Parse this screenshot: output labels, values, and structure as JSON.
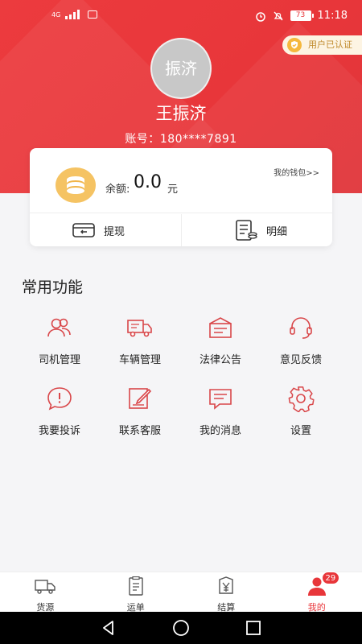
{
  "status_bar": {
    "network": "4G",
    "battery": "73",
    "time": "11:18"
  },
  "verified_badge": "用户已认证",
  "profile": {
    "avatar_text": "振济",
    "name": "王振济",
    "account_label": "账号：",
    "account_value": "180****7891"
  },
  "wallet": {
    "link": "我的钱包>>",
    "balance_label": "余额:",
    "balance_value": "0.0",
    "balance_unit": "元",
    "withdraw_label": "提现",
    "detail_label": "明细"
  },
  "section_title": "常用功能",
  "functions": [
    {
      "label": "司机管理",
      "icon": "drivers-icon"
    },
    {
      "label": "车辆管理",
      "icon": "truck-icon"
    },
    {
      "label": "法律公告",
      "icon": "announcement-icon"
    },
    {
      "label": "意见反馈",
      "icon": "headset-icon"
    },
    {
      "label": "我要投诉",
      "icon": "complaint-icon"
    },
    {
      "label": "联系客服",
      "icon": "edit-icon"
    },
    {
      "label": "我的消息",
      "icon": "message-icon"
    },
    {
      "label": "设置",
      "icon": "gear-icon"
    }
  ],
  "tabs": [
    {
      "label": "货源",
      "icon": "truck-icon"
    },
    {
      "label": "运单",
      "icon": "clipboard-icon"
    },
    {
      "label": "结算",
      "icon": "yen-icon"
    },
    {
      "label": "我的",
      "icon": "person-icon",
      "badge": "29",
      "active": true
    }
  ],
  "colors": {
    "brand_red": "#e8363a",
    "badge_gold": "#c08a2c",
    "coin": "#f5c363"
  }
}
